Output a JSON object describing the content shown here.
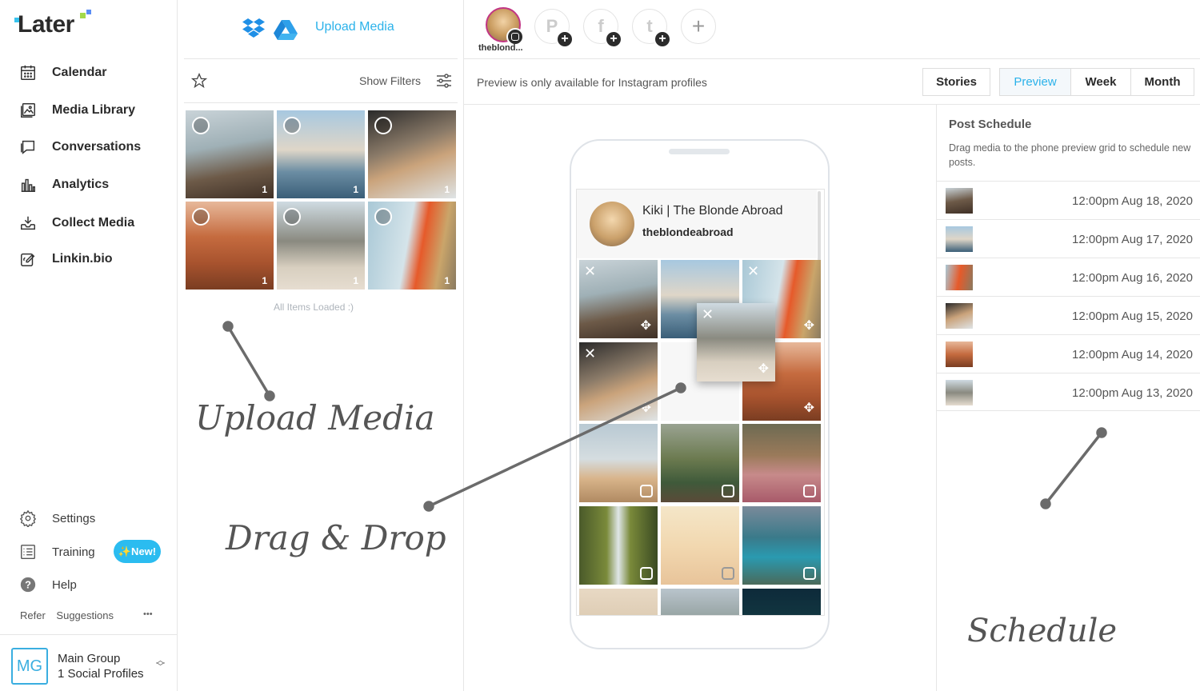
{
  "app": {
    "name": "Later"
  },
  "sidebar": {
    "items": [
      {
        "label": "Calendar",
        "icon": "calendar-icon"
      },
      {
        "label": "Media Library",
        "icon": "image-icon"
      },
      {
        "label": "Conversations",
        "icon": "chat-icon"
      },
      {
        "label": "Analytics",
        "icon": "bar-chart-icon"
      },
      {
        "label": "Collect Media",
        "icon": "download-tray-icon"
      },
      {
        "label": "Linkin.bio",
        "icon": "link-edit-icon"
      }
    ],
    "bottom_items": [
      {
        "label": "Settings",
        "icon": "gear-icon"
      },
      {
        "label": "Training",
        "icon": "checklist-icon"
      },
      {
        "label": "Help",
        "icon": "help-icon"
      }
    ],
    "new_badge": "✨New!",
    "refer_label": "Refer",
    "suggestions_label": "Suggestions",
    "more_label": "•••",
    "profile": {
      "initials": "MG",
      "name": "Main Group",
      "subtitle": "1 Social Profiles"
    }
  },
  "media": {
    "upload_label": "Upload Media",
    "show_filters_label": "Show Filters",
    "all_loaded": "All Items Loaded :)",
    "thumb_count": "1"
  },
  "annotations": {
    "upload": "Upload Media",
    "drag": "Drag & Drop",
    "schedule": "Schedule"
  },
  "topbar": {
    "profile_label": "theblond...",
    "add_symbol": "+",
    "pinterest": "P",
    "facebook": "f",
    "twitter": "t"
  },
  "subbar": {
    "notice": "Preview is only available for Instagram profiles",
    "tabs": [
      "Stories",
      "Preview",
      "Week",
      "Month"
    ],
    "active_tab": "Preview"
  },
  "preview": {
    "display_name": "Kiki | The Blonde Abroad",
    "handle": "theblondeabroad"
  },
  "schedule": {
    "title": "Post Schedule",
    "description": "Drag media to the phone preview grid to schedule new posts.",
    "rows": [
      "12:00pm Aug 18, 2020",
      "12:00pm Aug 17, 2020",
      "12:00pm Aug 16, 2020",
      "12:00pm Aug 15, 2020",
      "12:00pm Aug 14, 2020",
      "12:00pm Aug 13, 2020"
    ]
  },
  "colors": {
    "accent": "#2bbcf0",
    "instagram_ring": "#c13584",
    "text": "#2b2b2b"
  }
}
